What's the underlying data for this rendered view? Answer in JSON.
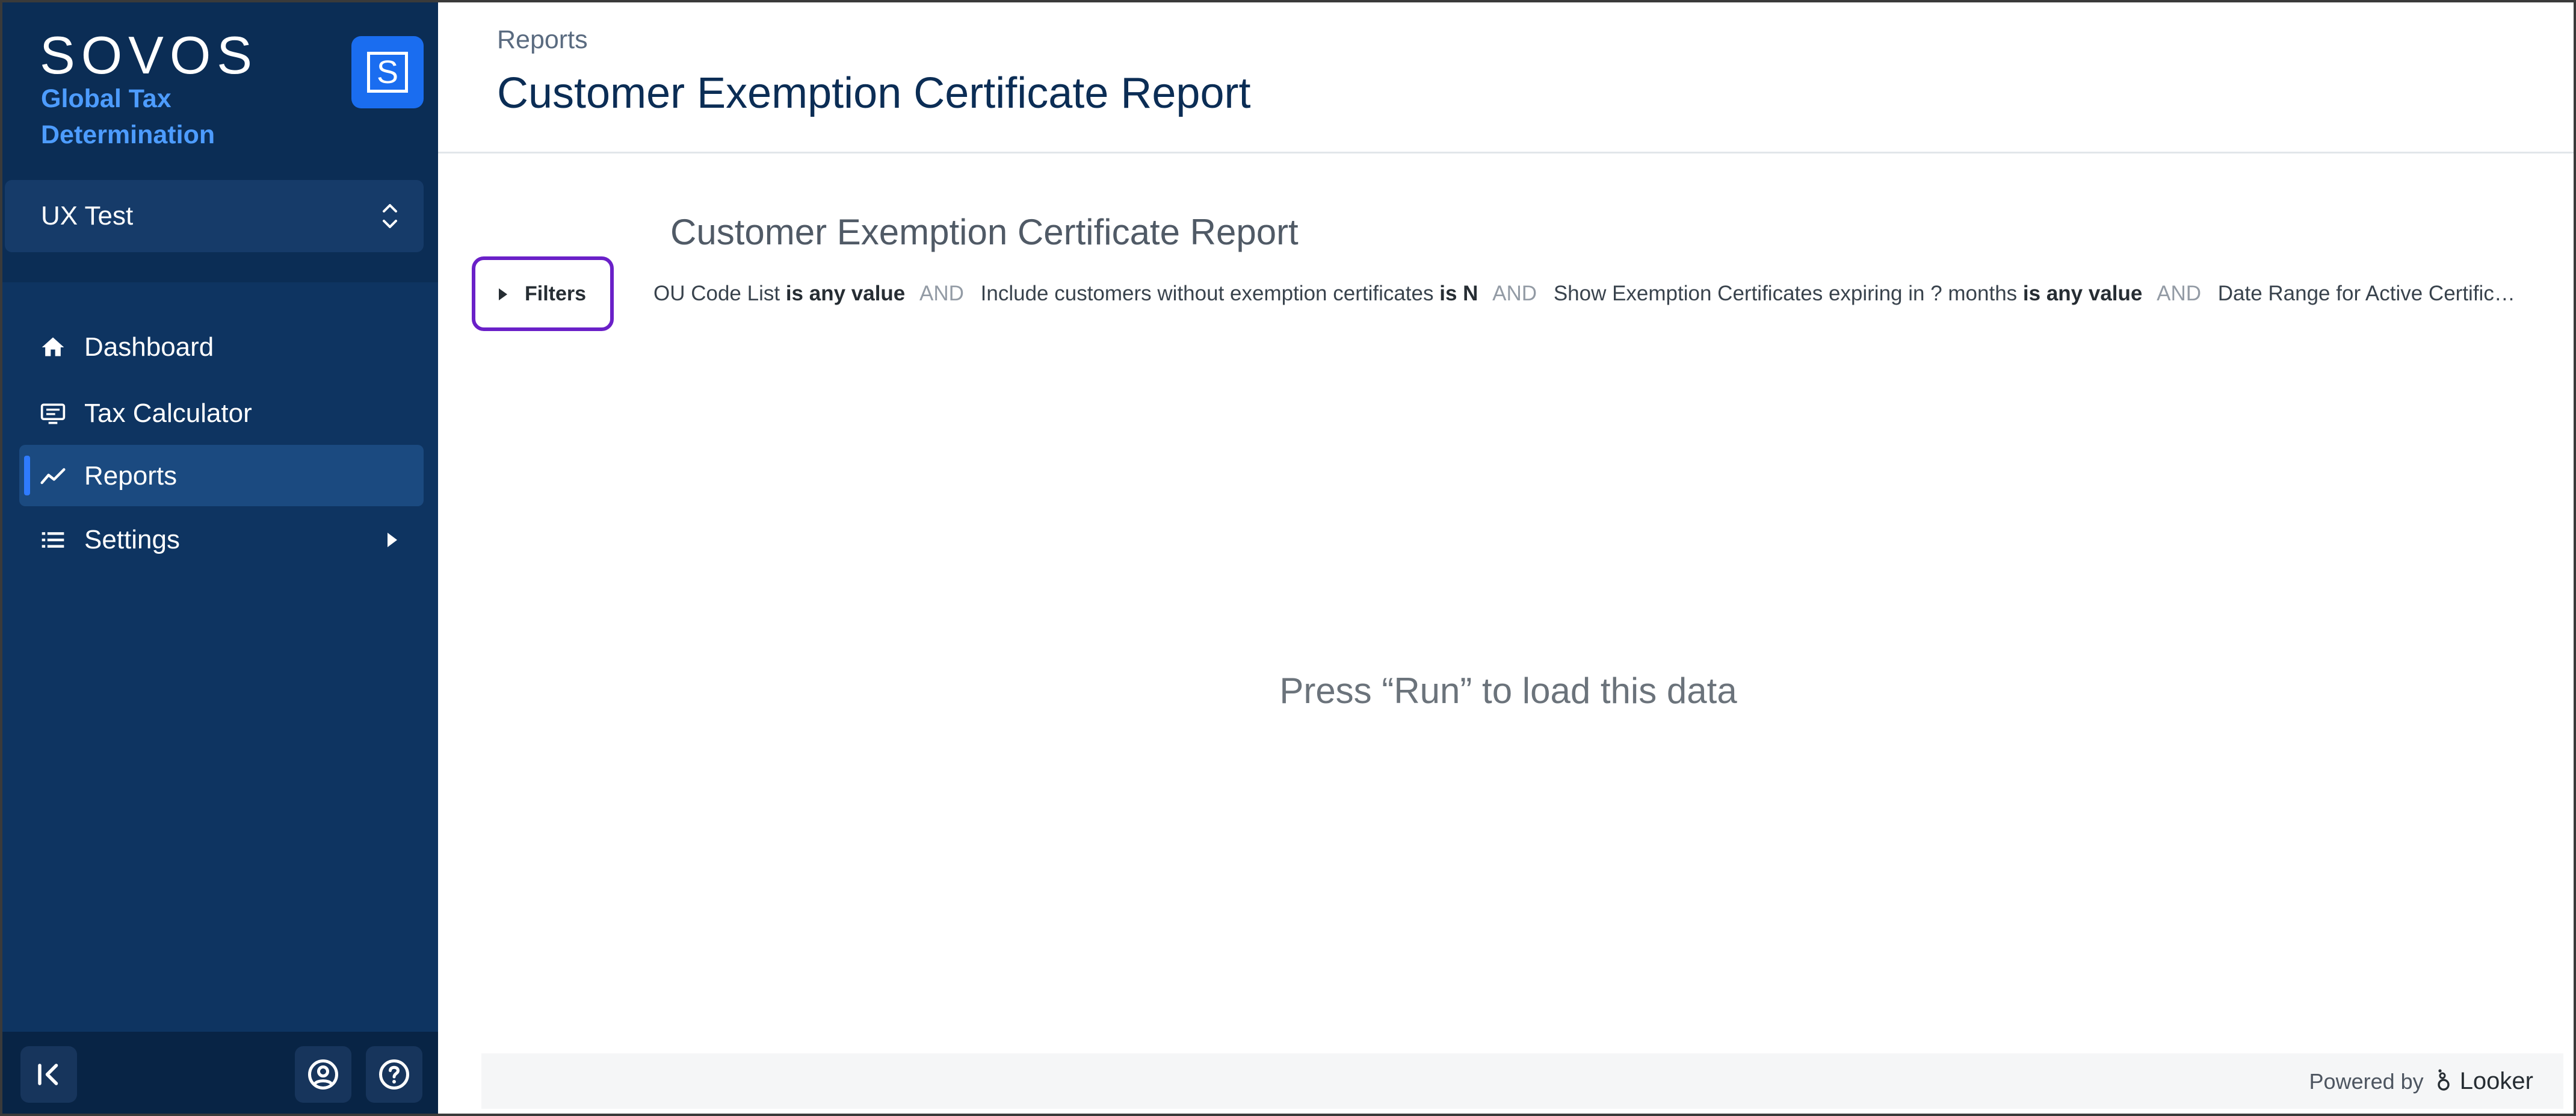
{
  "sidebar": {
    "brand": {
      "logo": "SOVOS",
      "subtitle": "Global Tax Determination",
      "badge": "S",
      "badge_color": "#1a6df0",
      "subtitle_color": "#4d9cff"
    },
    "tenant": {
      "label": "UX Test"
    },
    "nav": [
      {
        "label": "Dashboard",
        "icon": "home-icon",
        "active": false
      },
      {
        "label": "Tax Calculator",
        "icon": "calculator-icon",
        "active": false
      },
      {
        "label": "Reports",
        "icon": "chart-line-icon",
        "active": true
      },
      {
        "label": "Settings",
        "icon": "list-icon",
        "active": false,
        "has_submenu": true
      }
    ],
    "footer": {
      "collapse_icon": "collapse-sidebar-icon",
      "profile_icon": "user-circle-icon",
      "help_icon": "help-circle-icon"
    },
    "background_color": "#0b2d55",
    "active_accent": "#2f7bff"
  },
  "header": {
    "breadcrumb": "Reports",
    "title": "Customer Exemption Certificate Report"
  },
  "report": {
    "title": "Customer Exemption Certificate Report",
    "filters_label": "Filters",
    "filters_border_color": "#6a20c8",
    "filter_summary": [
      {
        "field": "OU Code List",
        "op": "is any value"
      },
      {
        "field": "Include customers without exemption certificates",
        "op": "is N"
      },
      {
        "field": "Show Exemption Certificates expiring in ? months",
        "op": "is any value"
      },
      {
        "field": "Date Range for Active Certificat…",
        "op": ""
      }
    ],
    "joiner": "AND",
    "empty_message": "Press “Run” to load this data"
  },
  "footer": {
    "powered_by": "Powered by",
    "brand": "Looker"
  }
}
